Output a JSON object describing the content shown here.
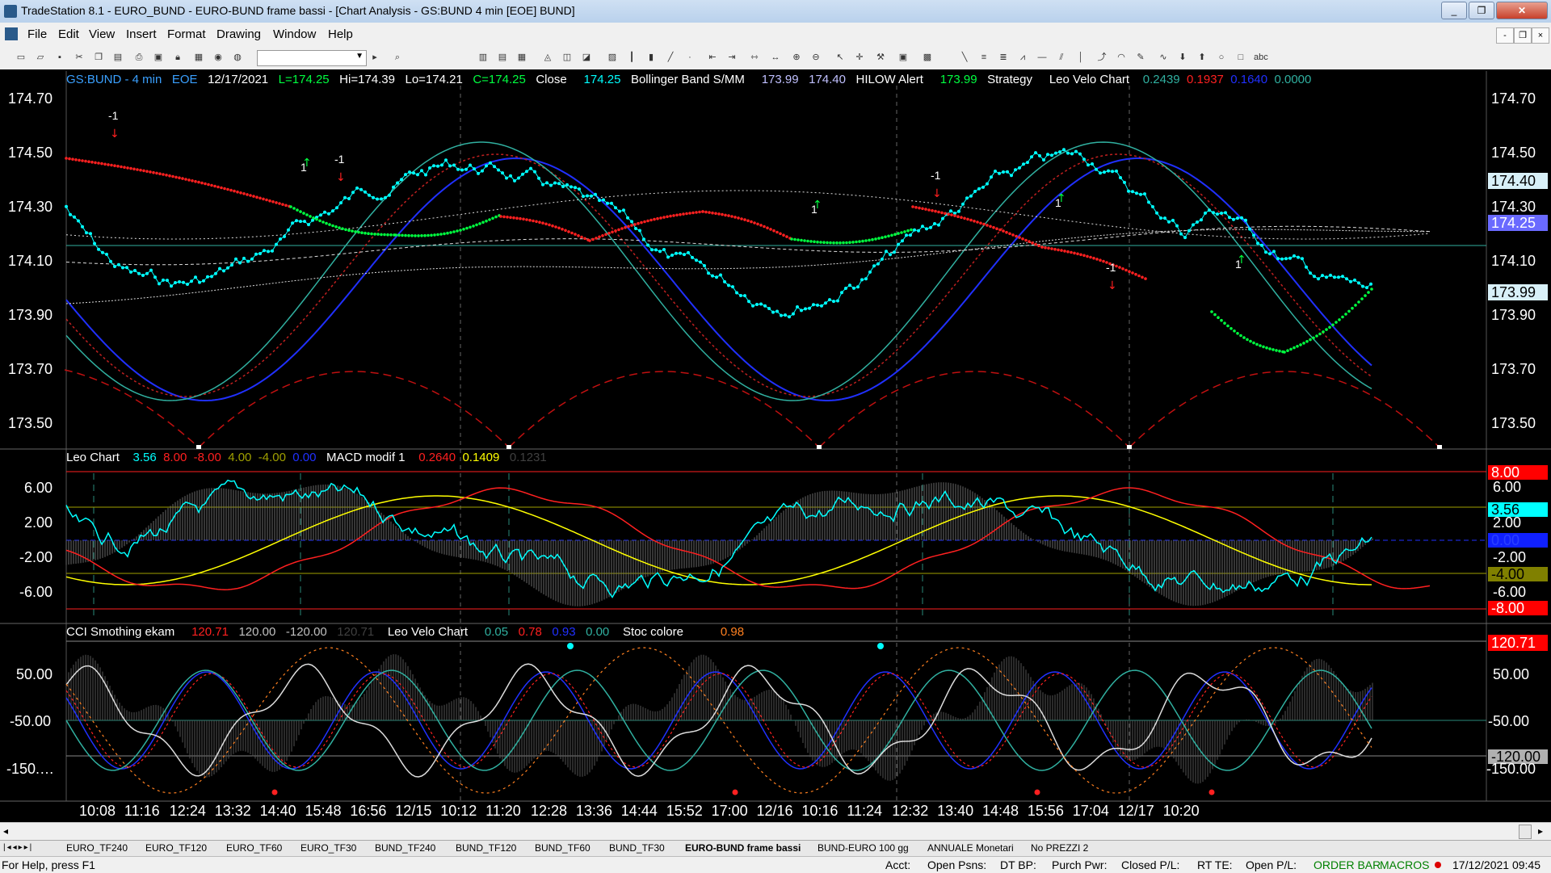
{
  "window": {
    "title": "TradeStation 8.1 - EURO_BUND - EURO-BUND frame bassi - [Chart Analysis - GS:BUND  4 min  [EOE] BUND]",
    "buttons": [
      "_",
      "❐",
      "✕"
    ]
  },
  "menu": [
    "File",
    "Edit",
    "View",
    "Insert",
    "Format",
    "Drawing",
    "Window",
    "Help"
  ],
  "mdi_buttons": [
    "-",
    "❐",
    "×"
  ],
  "header1": {
    "symbol": "GS:BUND - 4 min",
    "exch": "EOE",
    "date": "12/17/2021",
    "low_open": "L=174.25",
    "hi": "Hi=174.39",
    "lo": "Lo=174.21",
    "close_c": "C=174.25",
    "close_label": "Close",
    "close_val": "174.25",
    "bb_label": "Bollinger Band S/MM",
    "bb_v1": "173.99",
    "bb_v2": "174.40",
    "hilow_label": "HILOW Alert",
    "hilow_val": "173.99",
    "strategy": "Strategy",
    "leo_label": "Leo Velo Chart",
    "leo_v1": "0.2439",
    "leo_v2": "0.1937",
    "leo_v3": "0.1640",
    "leo_v4": "0.0000"
  },
  "header2": {
    "leo_label": "Leo Chart",
    "v1": "3.56",
    "v2": "8.00",
    "v3": "-8.00",
    "v4": "4.00",
    "v5": "-4.00",
    "v6": "0.00",
    "macd_label": "MACD modif 1",
    "m1": "0.2640",
    "m2": "0.1409",
    "m3": "0.1231"
  },
  "header3": {
    "cci_label": "CCI Smothing ekam",
    "c1": "120.71",
    "c2": "120.00",
    "c3": "-120.00",
    "c4": "120.71",
    "leo_label": "Leo Velo Chart",
    "l1": "0.05",
    "l2": "0.78",
    "l3": "0.93",
    "l4": "0.00",
    "stoc_label": "Stoc colore",
    "stoc_val": "0.98"
  },
  "price_axis": [
    "174.70",
    "174.50",
    "174.30",
    "174.10",
    "173.90",
    "173.70",
    "173.50"
  ],
  "price_labels": {
    "bb_upper": "174.40",
    "last": "174.25",
    "bb_lower": "173.99",
    "top_partial": "174.70",
    "p1": "174.30"
  },
  "osc_axis": [
    "6.00",
    "2.00",
    "-2.00",
    "-6.00"
  ],
  "osc_labels": [
    "8.00",
    "6.00",
    "3.56",
    "2.00",
    "0.00",
    "-2.00",
    "-4.00",
    "-6.00",
    "-8.00"
  ],
  "cci_axis": [
    "50.00",
    "-50.00",
    "-150.…"
  ],
  "cci_labels": [
    "120.71",
    "50.00",
    "-50.00",
    "-120.00",
    "-150.00"
  ],
  "time_axis": [
    "10:08",
    "11:16",
    "12:24",
    "13:32",
    "14:40",
    "15:48",
    "16:56",
    "12/15",
    "10:12",
    "11:20",
    "12:28",
    "13:36",
    "14:44",
    "15:52",
    "17:00",
    "12/16",
    "10:16",
    "11:24",
    "12:32",
    "13:40",
    "14:48",
    "15:56",
    "17:04",
    "12/17",
    "10:20"
  ],
  "signals": [
    "-1",
    "1",
    "-1",
    "1",
    "-1",
    "1",
    "-1",
    "1"
  ],
  "tabs": [
    "EURO_TF240",
    "EURO_TF120",
    "EURO_TF60",
    "EURO_TF30",
    "BUND_TF240",
    "BUND_TF120",
    "BUND_TF60",
    "BUND_TF30",
    "EURO-BUND frame bassi",
    "BUND-EURO 100 gg",
    "ANNUALE Monetari",
    "No PREZZI 2"
  ],
  "status": {
    "help": "For Help, press F1",
    "acct": "Acct:",
    "open_psns": "Open Psns:",
    "dt_bp": "DT BP:",
    "purch_pwr": "Purch Pwr:",
    "closed_pl": "Closed P/L:",
    "rt_te": "RT TE:",
    "open_pl": "Open P/L:",
    "order_bar": "ORDER BAR",
    "macros": "MACROS",
    "datetime": "17/12/2021 09:45"
  },
  "colors": {
    "cyan": "#00ffff",
    "red": "#ff2020",
    "green": "#00ff40",
    "blue": "#2030ff",
    "yellow": "#ffff00",
    "teal": "#30b0a0"
  }
}
